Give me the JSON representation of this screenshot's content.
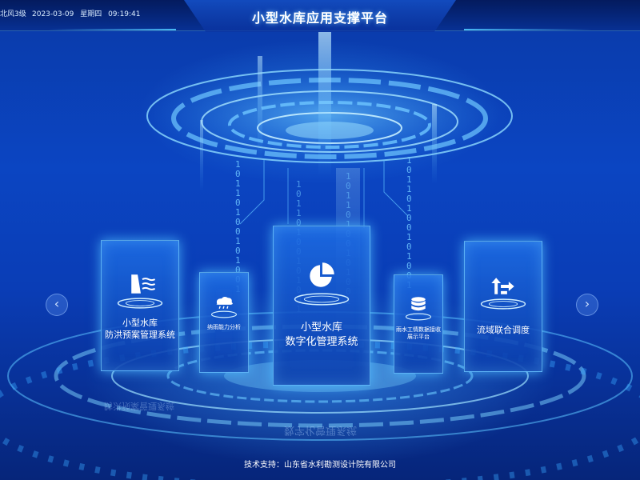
{
  "header": {
    "weather": "北风3级",
    "date": "2023-03-09",
    "weekday": "星期四",
    "time": "09:19:41",
    "title": "小型水库应用支撑平台"
  },
  "cards": [
    {
      "line1": "小型水库",
      "line2": "防洪预案管理系统",
      "icon": "dam-icon"
    },
    {
      "line1": "纳雨能力分析",
      "line2": "",
      "icon": "rain-cloud-icon"
    },
    {
      "line1": "小型水库",
      "line2": "数字化管理系统",
      "icon": "pie-chart-icon"
    },
    {
      "line1": "雨水工情数据接收",
      "line2": "展示平台",
      "icon": "database-icon"
    },
    {
      "line1": "流域联合调度",
      "line2": "",
      "icon": "dispatch-arrows-icon"
    }
  ],
  "nav": {
    "prev": "‹",
    "next": "›"
  },
  "footer": {
    "label": "技术支持：",
    "company": "山东省水利勘测设计院有限公司"
  },
  "binary_digits": "10110100101001"
}
